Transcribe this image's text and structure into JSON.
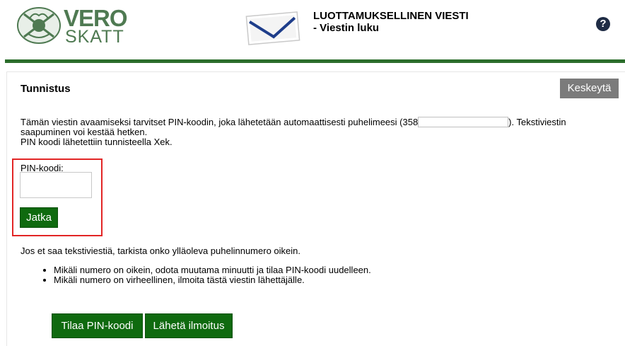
{
  "header": {
    "logo_primary": "VERO",
    "logo_secondary": "SKATT",
    "title_line1": "LUOTTAMUKSELLINEN VIESTI",
    "title_line2": "- Viestin luku",
    "help_icon": "?"
  },
  "colors": {
    "brand_green": "#0f6a0f",
    "header_rule": "#2b6d2b",
    "highlight": "#e22525",
    "cancel_grey": "#7b7b7b"
  },
  "section": {
    "title": "Tunnistus",
    "cancel_label": "Keskeytä"
  },
  "intro": {
    "text_before_phone": "Tämän viestin avaamiseksi tarvitset PIN-koodin, joka lähetetään automaattisesti puhelimeesi (358",
    "text_after_phone": "). Tekstiviestin saapuminen voi kestää hetken.",
    "sender_note": "PIN koodi lähetettiin tunnisteella Xek."
  },
  "pin": {
    "label": "PIN-koodi:",
    "value": "",
    "submit_label": "Jatka"
  },
  "help": {
    "text": "Jos et saa tekstiviestiä, tarkista onko ylläoleva puhelinnumero oikein.",
    "bullets": [
      "Mikäli numero on oikein, odota muutama minuutti ja tilaa PIN-koodi uudelleen.",
      "Mikäli numero on virheellinen, ilmoita tästä viestin lähettäjälle."
    ]
  },
  "actions": {
    "order_pin_label": "Tilaa PIN-koodi",
    "notify_label": "Lähetä ilmoitus"
  }
}
